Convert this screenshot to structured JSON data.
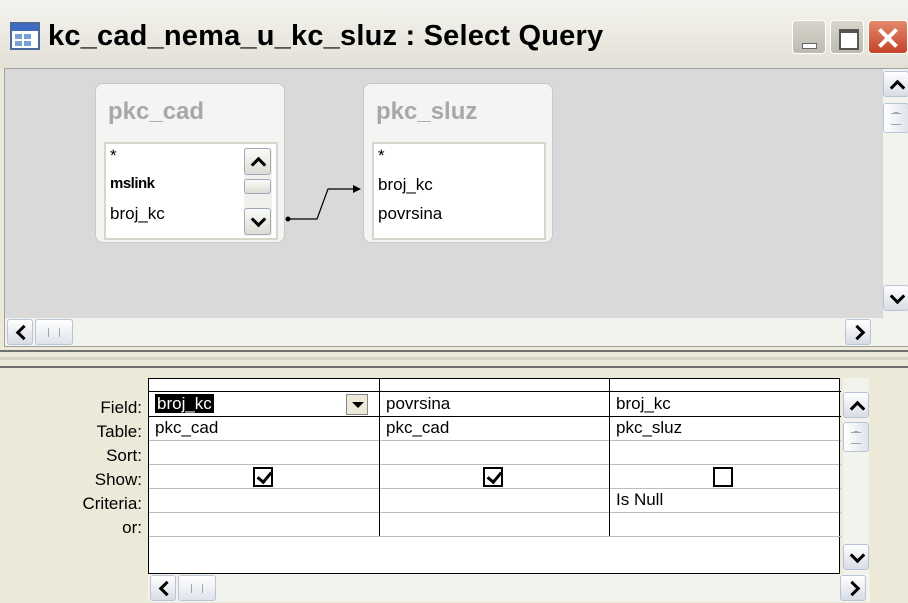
{
  "window": {
    "title": "kc_cad_nema_u_kc_sluz : Select Query",
    "icon": "query-icon"
  },
  "design_view": {
    "tables": [
      {
        "name": "pkc_cad",
        "fields": [
          "*",
          "mslink",
          "broj_kc"
        ],
        "bold_field": "mslink"
      },
      {
        "name": "pkc_sluz",
        "fields": [
          "*",
          "broj_kc",
          "povrsina"
        ]
      }
    ],
    "join": {
      "from": "pkc_cad.broj_kc",
      "to": "pkc_sluz.broj_kc",
      "type": "left-outer"
    }
  },
  "grid": {
    "row_labels": [
      "Field:",
      "Table:",
      "Sort:",
      "Show:",
      "Criteria:",
      "or:"
    ],
    "columns": [
      {
        "field": "broj_kc",
        "table": "pkc_cad",
        "sort": "",
        "show": true,
        "criteria": "",
        "or": "",
        "selected": true
      },
      {
        "field": "povrsina",
        "table": "pkc_cad",
        "sort": "",
        "show": true,
        "criteria": "",
        "or": ""
      },
      {
        "field": "broj_kc",
        "table": "pkc_sluz",
        "sort": "",
        "show": false,
        "criteria": "Is Null",
        "or": ""
      }
    ]
  }
}
